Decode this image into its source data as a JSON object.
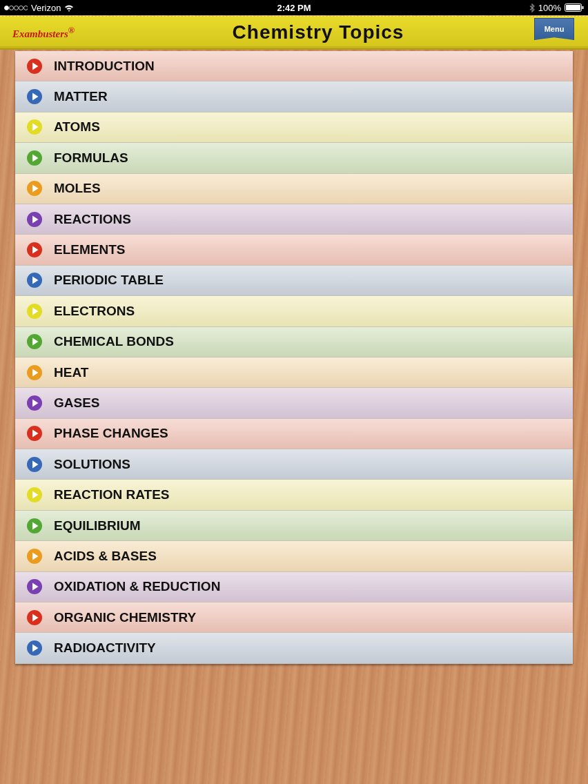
{
  "status_bar": {
    "carrier": "Verizon",
    "time": "2:42 PM",
    "battery": "100%"
  },
  "header": {
    "logo": "Exambusters$^{®}$",
    "title": "Chemistry Topics",
    "menu_button": "Menu"
  },
  "topics": [
    {
      "label": "INTRODUCTION",
      "color": "#d9301e"
    },
    {
      "label": "MATTER",
      "color": "#3569b8"
    },
    {
      "label": "ATOMS",
      "color": "#e2dc24"
    },
    {
      "label": "FORMULAS",
      "color": "#52a832"
    },
    {
      "label": "MOLES",
      "color": "#eb9c1e"
    },
    {
      "label": "REACTIONS",
      "color": "#7a3fb0"
    },
    {
      "label": "ELEMENTS",
      "color": "#d9301e"
    },
    {
      "label": "PERIODIC TABLE",
      "color": "#3569b8"
    },
    {
      "label": "ELECTRONS",
      "color": "#e2dc24"
    },
    {
      "label": "CHEMICAL BONDS",
      "color": "#52a832"
    },
    {
      "label": "HEAT",
      "color": "#eb9c1e"
    },
    {
      "label": "GASES",
      "color": "#7a3fb0"
    },
    {
      "label": "PHASE CHANGES",
      "color": "#d9301e"
    },
    {
      "label": "SOLUTIONS",
      "color": "#3569b8"
    },
    {
      "label": "REACTION RATES",
      "color": "#e2dc24"
    },
    {
      "label": "EQUILIBRIUM",
      "color": "#52a832"
    },
    {
      "label": "ACIDS & BASES",
      "color": "#eb9c1e"
    },
    {
      "label": "OXIDATION & REDUCTION",
      "color": "#7a3fb0"
    },
    {
      "label": "ORGANIC CHEMISTRY",
      "color": "#d9301e"
    },
    {
      "label": "RADIOACTIVITY",
      "color": "#3569b8"
    }
  ]
}
